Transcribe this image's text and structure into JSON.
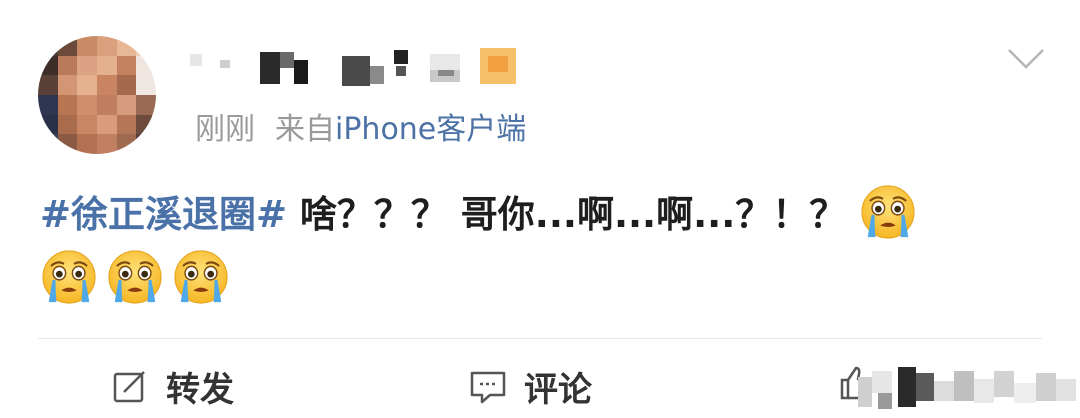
{
  "post": {
    "timestamp": "刚刚",
    "source_prefix": "来自",
    "source": "iPhone客户端",
    "hashtag": "#徐正溪退圈#",
    "text": " 啥？？？ 哥你...啊...啊...？！？ ",
    "emojis": [
      "crying-face",
      "crying-face",
      "crying-face",
      "crying-face"
    ]
  },
  "actions": {
    "repost_label": "转发",
    "comment_label": "评论",
    "like_label": ""
  },
  "colors": {
    "link": "#4a72a8",
    "meta_gray": "#9a9a9a",
    "text": "#1e1e1e"
  }
}
